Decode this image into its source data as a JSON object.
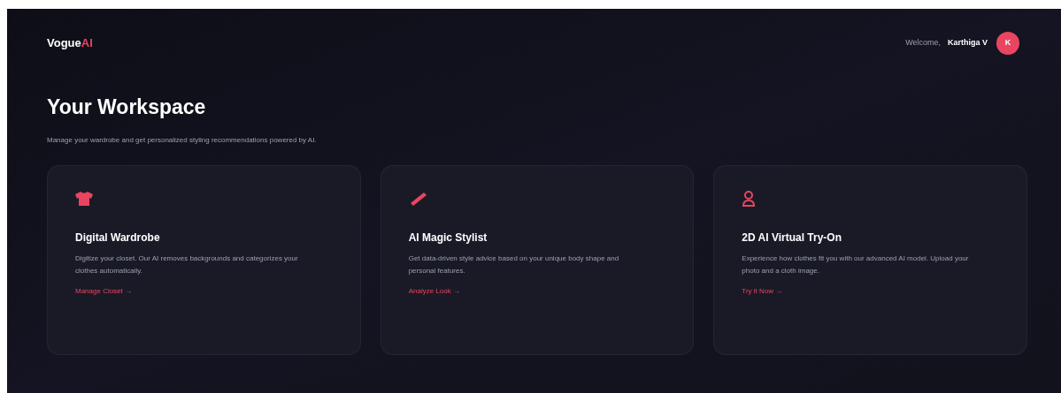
{
  "header": {
    "brand": {
      "name": "Vogue",
      "accent": "AI"
    },
    "welcome": "Welcome,",
    "user_name": "Karthiga V",
    "avatar": "K"
  },
  "page": {
    "title": "Your Workspace",
    "subtitle": "Manage your wardrobe and get personalized styling recommendations powered by AI."
  },
  "cards": [
    {
      "title": "Digital Wardrobe",
      "description": "Digitize your closet. Our AI removes backgrounds and categorizes your clothes automatically.",
      "link": "Manage Closet →"
    },
    {
      "title": "AI Magic Stylist",
      "description": "Get data-driven style advice based on your unique body shape and personal features.",
      "link": "Analyze Look →"
    },
    {
      "title": "2D AI Virtual Try-On",
      "description": "Experience how clothes fit you with our advanced AI model. Upload your photo and a cloth image.",
      "link": "Try it Now →"
    }
  ]
}
